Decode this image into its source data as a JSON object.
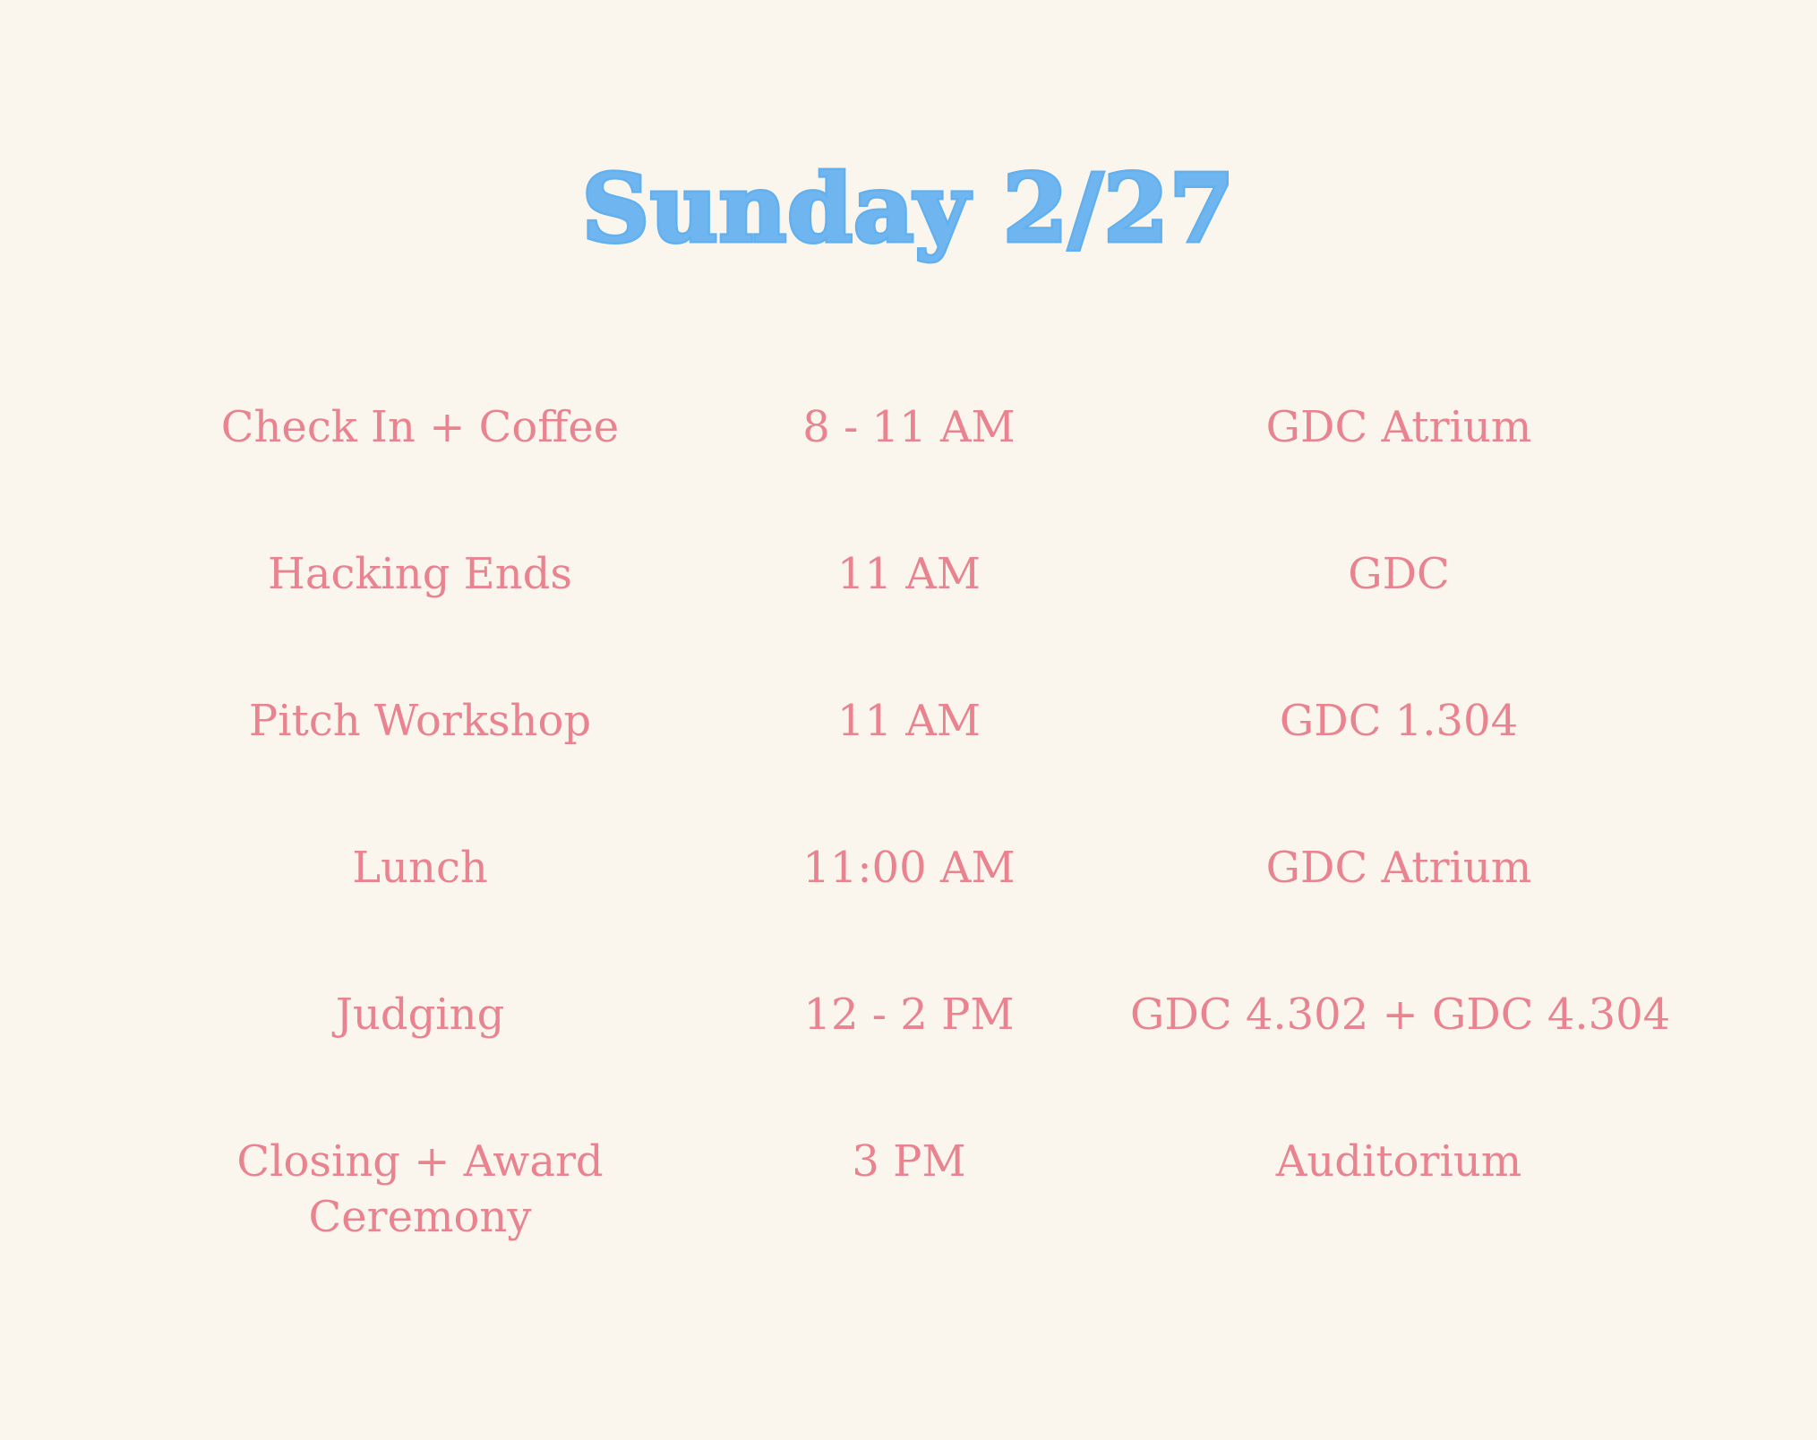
{
  "title": "Sunday 2/27",
  "colors": {
    "background": "#faf6ee",
    "title": "#62b0ee",
    "text": "#e8838f"
  },
  "schedule": [
    {
      "event": "Check In + Coffee",
      "time": "8 - 11 AM",
      "location": "GDC Atrium"
    },
    {
      "event": "Hacking Ends",
      "time": "11 AM",
      "location": "GDC"
    },
    {
      "event": "Pitch Workshop",
      "time": "11 AM",
      "location": "GDC 1.304"
    },
    {
      "event": "Lunch",
      "time": "11:00 AM",
      "location": "GDC Atrium"
    },
    {
      "event": "Judging",
      "time": "12 - 2 PM",
      "location": "GDC 4.302 + GDC 4.304"
    },
    {
      "event": "Closing + Award Ceremony",
      "time": "3 PM",
      "location": "Auditorium"
    }
  ]
}
